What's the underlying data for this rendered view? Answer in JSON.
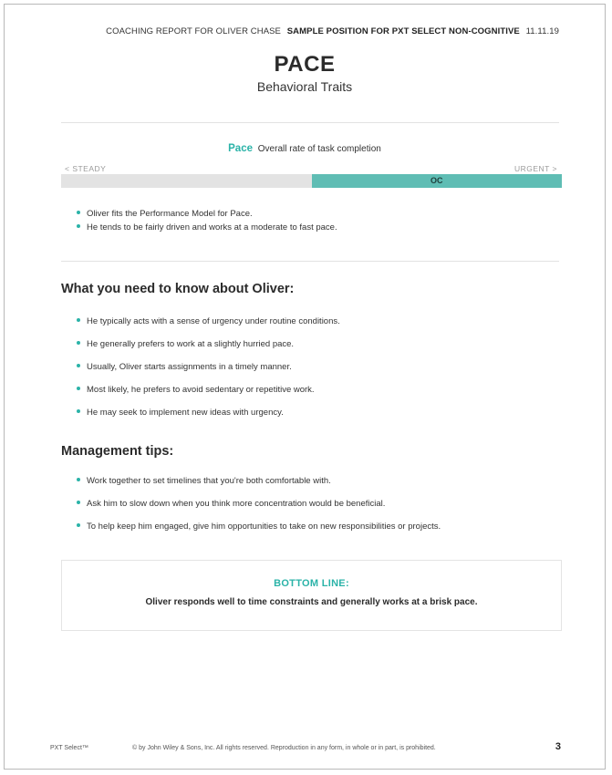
{
  "header": {
    "report_for": "COACHING REPORT FOR OLIVER CHASE",
    "position": "SAMPLE POSITION FOR PXT SELECT NON-COGNITIVE",
    "date": "11.11.19"
  },
  "title": "PACE",
  "subtitle": "Behavioral Traits",
  "trait": {
    "name": "Pace",
    "description": "Overall rate of task completion",
    "scale_left": "< STEADY",
    "scale_right": "URGENT >",
    "marker_label": "OC",
    "performance_model_range": [
      0.5,
      1.0
    ],
    "colors": {
      "accent": "#2bb3a8",
      "model_band": "#5fbdb4",
      "track": "#e3e3e3"
    }
  },
  "summary_bullets": [
    "Oliver fits the Performance Model for Pace.",
    "He tends to be fairly driven and works at a moderate to fast pace."
  ],
  "know_section": {
    "heading": "What you need to know about Oliver:",
    "items": [
      "He typically acts with a sense of urgency under routine conditions.",
      "He generally prefers to work at a slightly hurried pace.",
      "Usually, Oliver starts assignments in a timely manner.",
      "Most likely, he prefers to avoid sedentary or repetitive work.",
      "He may seek to implement new ideas with urgency."
    ]
  },
  "tips_section": {
    "heading": "Management tips:",
    "items": [
      "Work together to set timelines that you're both comfortable with.",
      "Ask him to slow down when you think more concentration would be beneficial.",
      "To help keep him engaged, give him opportunities to take on new responsibilities or projects."
    ]
  },
  "bottom_line": {
    "title": "BOTTOM LINE:",
    "text": "Oliver responds well to time constraints and generally works at a brisk pace."
  },
  "footer": {
    "product": "PXT Select™",
    "copyright": "© by John Wiley & Sons, Inc. All rights reserved. Reproduction in any form, in whole or in part, is prohibited.",
    "page_number": "3"
  }
}
